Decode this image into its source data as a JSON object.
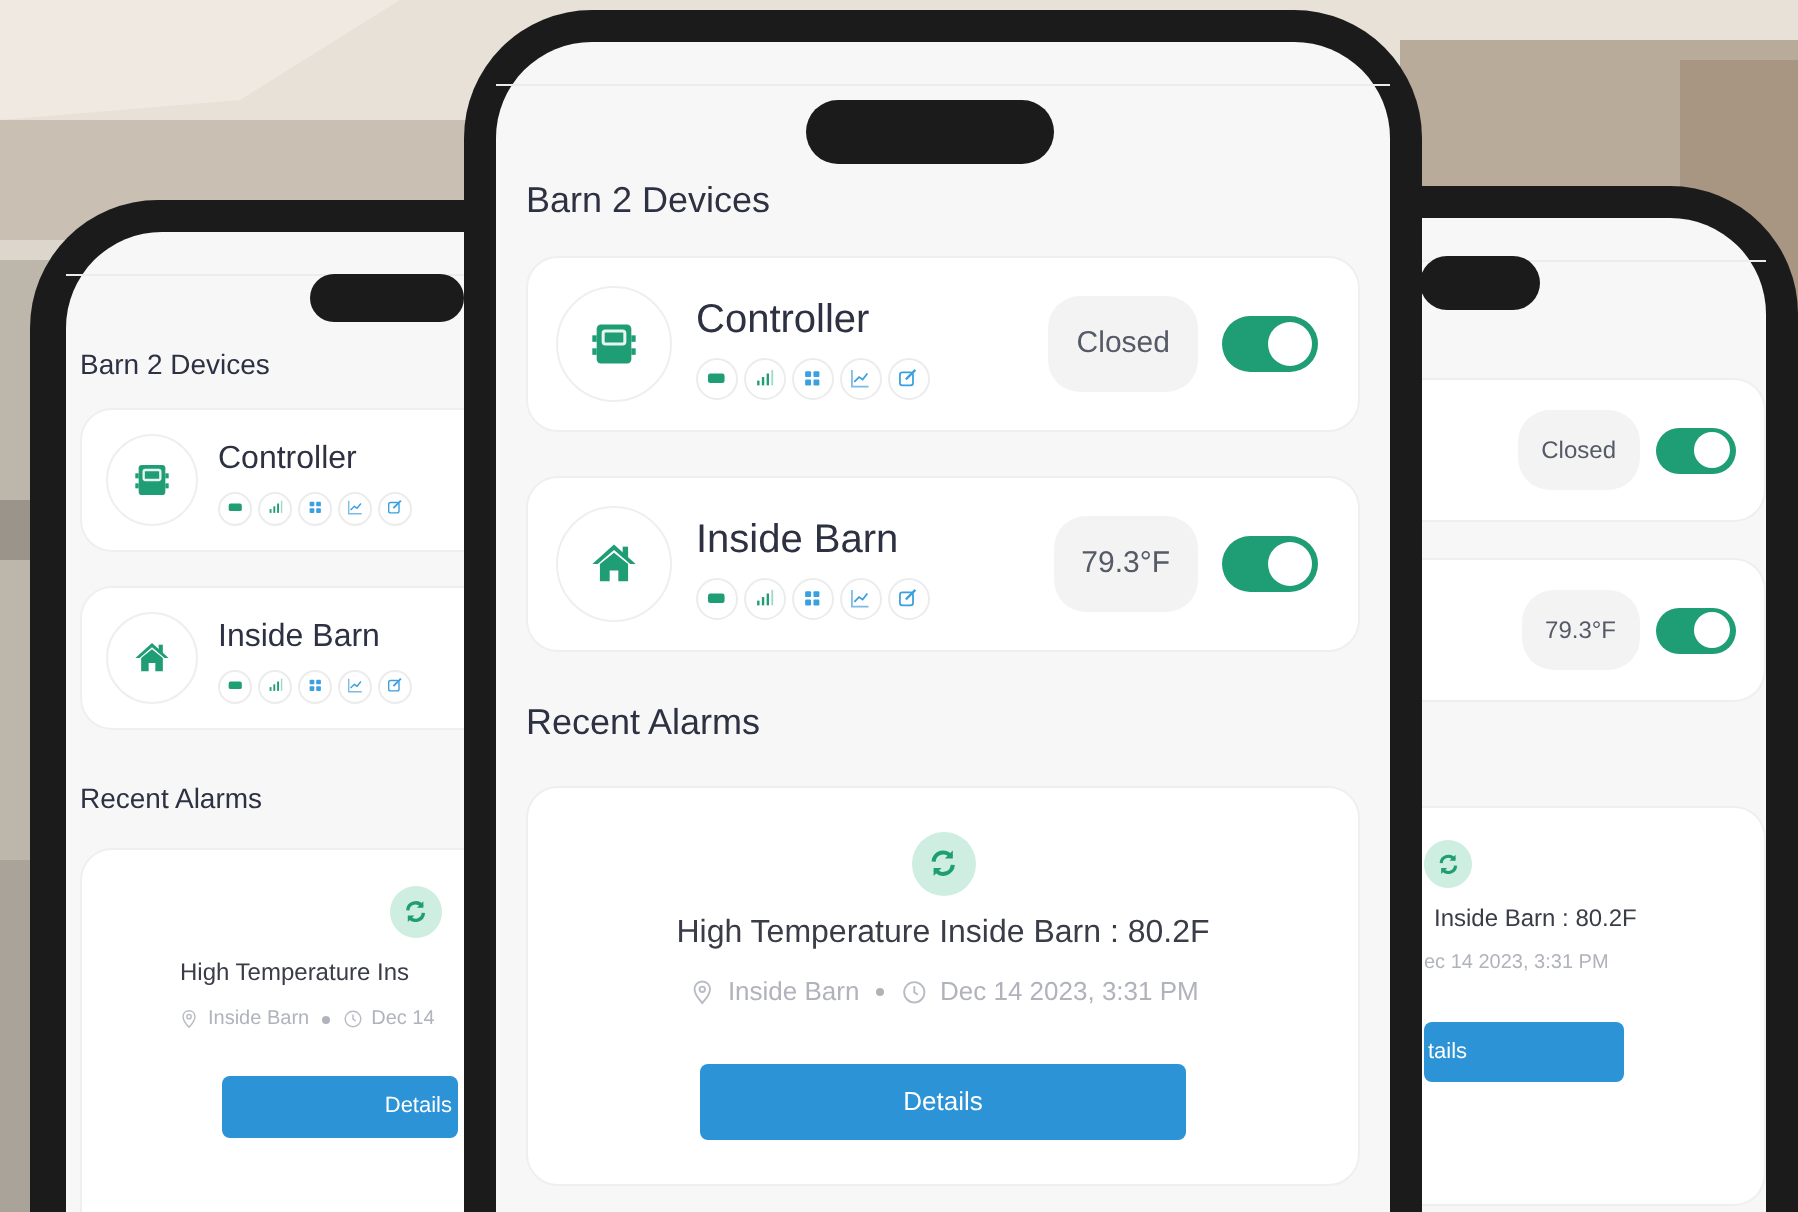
{
  "phones": [
    {
      "kind": "left",
      "section_title": "Barn 2 Devices",
      "devices": [
        {
          "kind": "controller",
          "name": "Controller"
        },
        {
          "kind": "house",
          "name": "Inside Barn"
        }
      ],
      "alarms_title": "Recent Alarms",
      "alarms": [
        {
          "title": "High Temperature Ins",
          "location": "Inside Barn",
          "time": "Dec 14",
          "button": "Details"
        }
      ]
    },
    {
      "kind": "center",
      "section_title": "Barn 2 Devices",
      "devices": [
        {
          "kind": "controller",
          "name": "Controller",
          "status": "Closed",
          "on": true
        },
        {
          "kind": "house",
          "name": "Inside Barn",
          "status": "79.3°F",
          "on": true
        }
      ],
      "alarms_title": "Recent Alarms",
      "alarms": [
        {
          "title": "High Temperature Inside Barn : 80.2F",
          "location": "Inside Barn",
          "time": "Dec 14 2023, 3:31 PM",
          "button": "Details"
        }
      ]
    },
    {
      "kind": "right",
      "devices": [
        {
          "status": "Closed",
          "on": true
        },
        {
          "status": "79.3°F",
          "on": true
        }
      ],
      "alarms": [
        {
          "title": "Inside Barn : 80.2F",
          "time": "ec 14 2023, 3:31 PM",
          "button": "tails"
        }
      ]
    }
  ]
}
